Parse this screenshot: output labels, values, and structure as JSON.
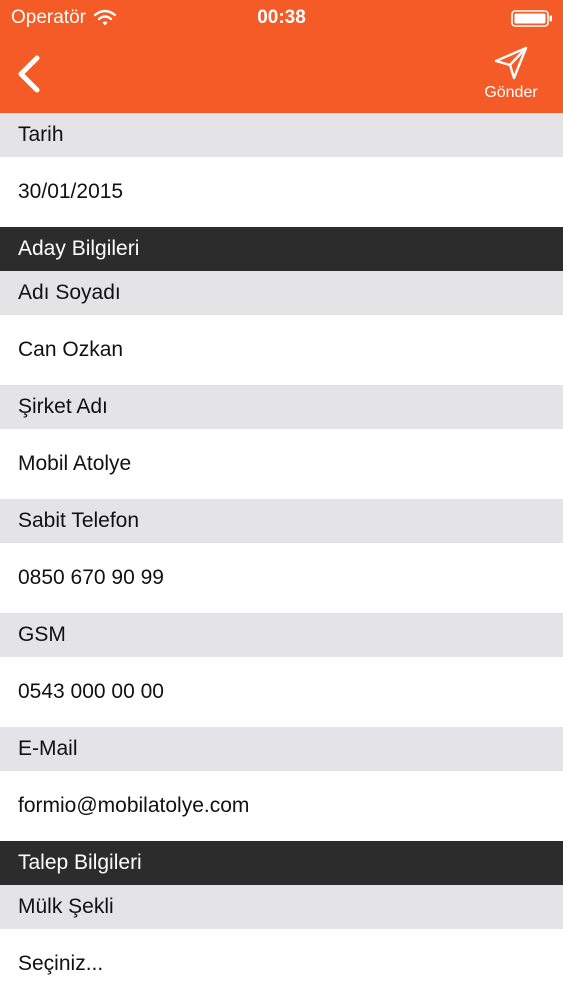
{
  "status_bar": {
    "carrier": "Operatör",
    "time": "00:38"
  },
  "nav": {
    "send_label": "Gönder",
    "back_icon": "chevron-left-icon",
    "send_icon": "paper-plane-icon"
  },
  "colors": {
    "accent": "#f45b26",
    "label_bg": "#e4e4e7",
    "section_bg": "#2c2c2c"
  },
  "form": {
    "tarih_label": "Tarih",
    "tarih_value": "30/01/2015",
    "section_aday": "Aday Bilgileri",
    "adi_soyadi_label": "Adı Soyadı",
    "adi_soyadi_value": "Can Ozkan",
    "sirket_label": "Şirket Adı",
    "sirket_value": "Mobil Atolye",
    "sabit_tel_label": "Sabit Telefon",
    "sabit_tel_value": "0850 670 90 99",
    "gsm_label": "GSM",
    "gsm_value": "0543 000 00 00",
    "email_label": "E-Mail",
    "email_value": "formio@mobilatolye.com",
    "section_talep": "Talep Bilgileri",
    "mulk_sekli_label": "Mülk Şekli",
    "mulk_sekli_value": "Seçiniz..."
  }
}
